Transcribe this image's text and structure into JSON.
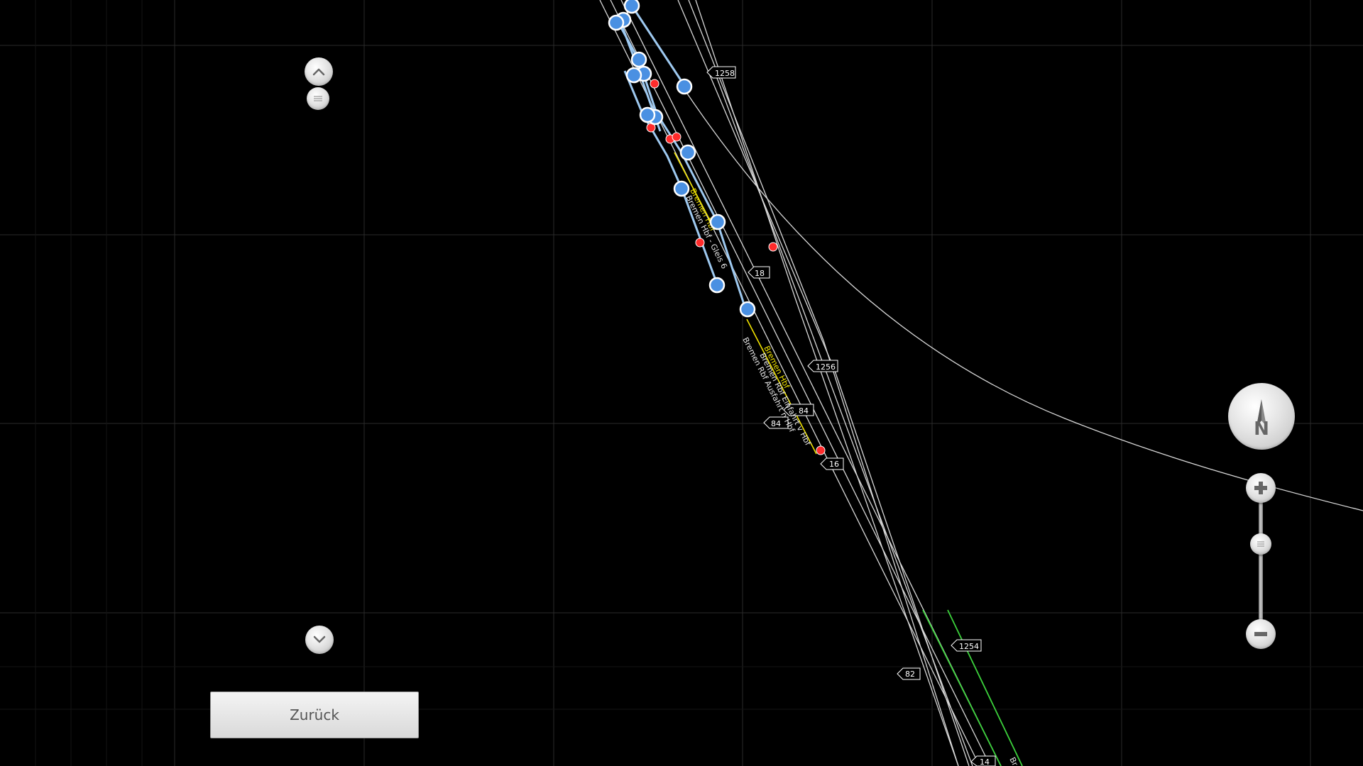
{
  "map": {
    "km_markers": [
      "1258",
      "1256",
      "1254",
      "18",
      "84",
      "84",
      "16",
      "82",
      "14"
    ],
    "track_labels": [
      "Bremen Hbf",
      "Bremen Hbf - Gleis 6",
      "Bremen Hbf",
      "Bremen Rbf Einfahrt v Hbf",
      "Bremen Rbf Ausfahrt n Hbf",
      "Br"
    ],
    "colors": {
      "background": "#000000",
      "grid": "#3a3a3a",
      "track": "#d8d8d8",
      "highlight_track": "#9ec9f0",
      "yellow_track": "#f2e400",
      "green_track": "#3cd23c",
      "node_blue": "#4a90e2",
      "node_red": "#ff2b2b"
    }
  },
  "controls": {
    "scroll_up_icon": "chevron-up-icon",
    "scroll_handle_icon": "grip-icon",
    "scroll_down_icon": "chevron-down-icon",
    "compass_label": "N",
    "zoom_in_icon": "plus-icon",
    "zoom_out_icon": "minus-icon",
    "back_label": "Zurück"
  }
}
